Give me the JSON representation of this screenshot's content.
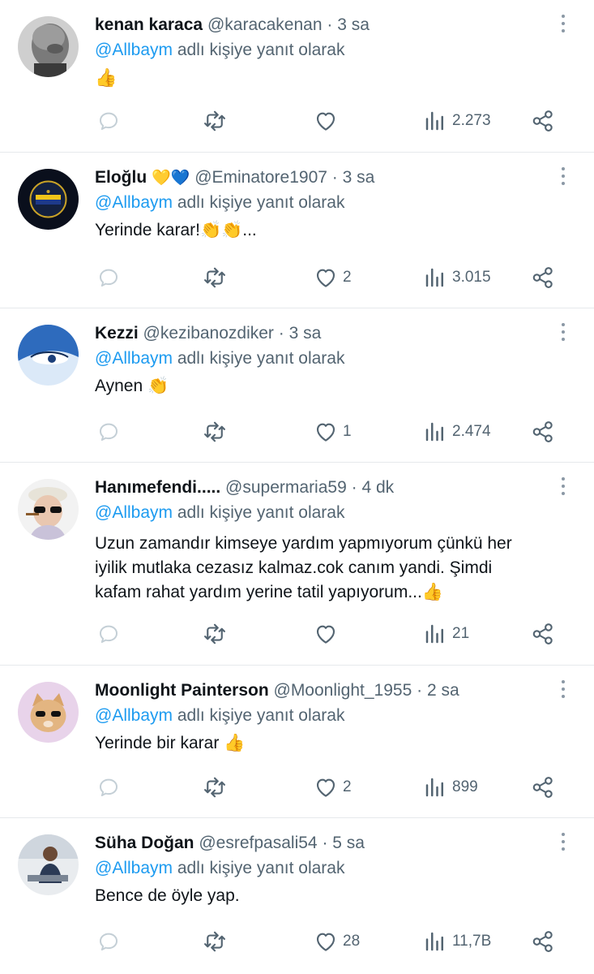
{
  "tweets": [
    {
      "name": "kenan karaca",
      "name_emoji": "",
      "handle": "@karacakenan",
      "time": "3 sa",
      "reply_mention": "@Allbaym",
      "reply_suffix": "adlı kişiye yanıt olarak",
      "text": "👍",
      "likes": "",
      "views": "2.273",
      "avatar_icon": "bald-man-avatar"
    },
    {
      "name": "Eloğlu",
      "name_emoji": "💛💙",
      "handle": "@Eminatore1907",
      "time": "3 sa",
      "reply_mention": "@Allbaym",
      "reply_suffix": "adlı kişiye yanıt olarak",
      "text": "Yerinde karar!👏👏...",
      "likes": "2",
      "views": "3.015",
      "avatar_icon": "fenerbahce-crest-avatar"
    },
    {
      "name": "Kezzi",
      "name_emoji": "",
      "handle": "@kezibanozdiker",
      "time": "3 sa",
      "reply_mention": "@Allbaym",
      "reply_suffix": "adlı kişiye yanıt olarak",
      "text": "Aynen 👏",
      "likes": "1",
      "views": "2.474",
      "avatar_icon": "blue-eye-avatar"
    },
    {
      "name": "Hanımefendi.....",
      "name_emoji": "",
      "handle": "@supermaria59",
      "time": "4 dk",
      "reply_mention": "@Allbaym",
      "reply_suffix": "adlı kişiye yanıt olarak",
      "text_lines": [
        "Uzun zamandır kimseye yardım yapmıyorum çünkü her",
        "iyilik mutlaka cezasız kalmaz.cok canım yandi. Şimdi",
        "kafam rahat yardım yerine tatil yapıyorum...👍"
      ],
      "likes": "",
      "views": "21",
      "avatar_icon": "sunglasses-lady-avatar"
    },
    {
      "name": "Moonlight Painterson",
      "name_emoji": "",
      "handle": "@Moonlight_1955",
      "time": "2 sa",
      "reply_mention": "@Allbaym",
      "reply_suffix": "adlı kişiye yanıt olarak",
      "text": "Yerinde bir karar 👍",
      "likes": "2",
      "views": "899",
      "avatar_icon": "cat-avatar"
    },
    {
      "name": "Süha Doğan",
      "name_emoji": "",
      "handle": "@esrefpasali54",
      "time": "5 sa",
      "reply_mention": "@Allbaym",
      "reply_suffix": "adlı kişiye yanıt olarak",
      "text": "Bence de öyle yap.",
      "likes": "28",
      "views": "11,7B",
      "avatar_icon": "seated-man-avatar"
    }
  ],
  "separator": "·",
  "colors": {
    "mention": "#1d9bf0",
    "secondary": "#536471",
    "border": "#e6e9ec"
  },
  "action_icons": [
    "reply-icon",
    "retweet-icon",
    "like-icon",
    "views-icon",
    "share-icon"
  ]
}
